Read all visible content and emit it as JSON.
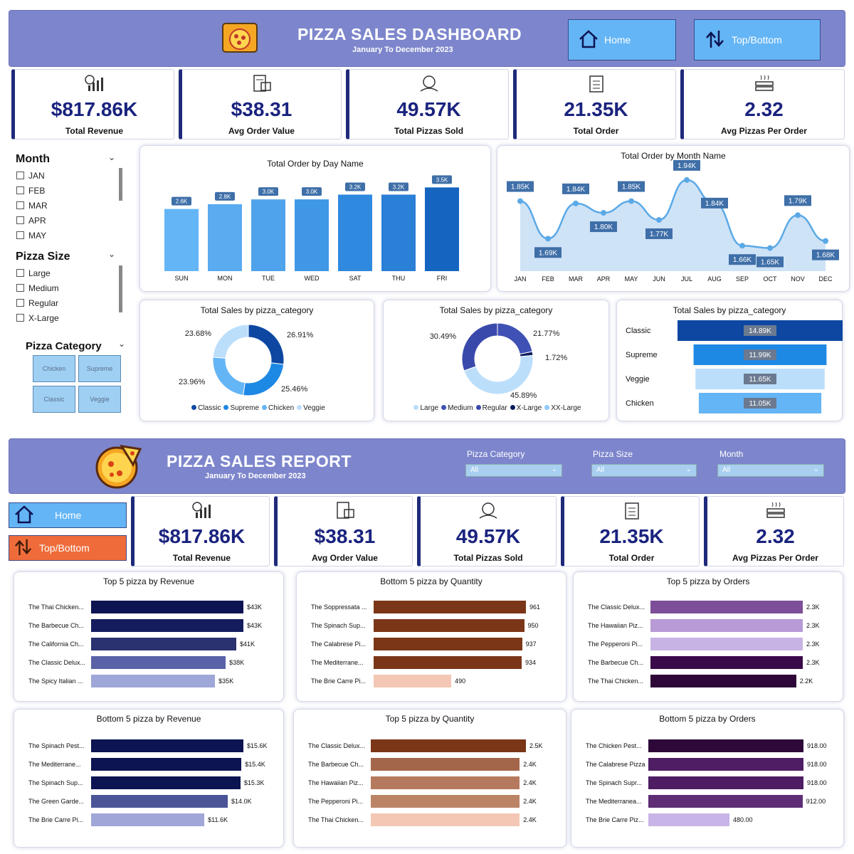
{
  "dashboard": {
    "title": "PIZZA SALES DASHBOARD",
    "subtitle": "January To December 2023",
    "home_label": "Home",
    "topbottom_label": "Top/Bottom"
  },
  "kpis": [
    {
      "value": "$817.86K",
      "label": "Total Revenue"
    },
    {
      "value": "$38.31",
      "label": "Avg Order Value"
    },
    {
      "value": "49.57K",
      "label": "Total Pizzas Sold"
    },
    {
      "value": "21.35K",
      "label": "Total Order"
    },
    {
      "value": "2.32",
      "label": "Avg Pizzas Per Order"
    }
  ],
  "slicers": {
    "month": {
      "title": "Month",
      "items": [
        "JAN",
        "FEB",
        "MAR",
        "APR",
        "MAY"
      ]
    },
    "size": {
      "title": "Pizza Size",
      "items": [
        "Large",
        "Medium",
        "Regular",
        "X-Large"
      ]
    },
    "category": {
      "title": "Pizza Category",
      "tiles": [
        "Chicken",
        "Supreme",
        "Classic",
        "Veggie"
      ]
    }
  },
  "chart_data": [
    {
      "type": "bar",
      "title": "Total Order by Day Name",
      "categories": [
        "SUN",
        "MON",
        "TUE",
        "WED",
        "SAT",
        "THU",
        "FRI"
      ],
      "values": [
        2.6,
        2.8,
        3.0,
        3.0,
        3.2,
        3.2,
        3.5
      ],
      "labels": [
        "2.6K",
        "2.8K",
        "3.0K",
        "3.0K",
        "3.2K",
        "3.2K",
        "3.5K"
      ],
      "colors": [
        "#64b5f6",
        "#5aabf0",
        "#4fa3ec",
        "#3f97e6",
        "#2f89de",
        "#2a7fd6",
        "#1565c0"
      ]
    },
    {
      "type": "area",
      "title": "Total Order by Month Name",
      "categories": [
        "JAN",
        "FEB",
        "MAR",
        "APR",
        "MAY",
        "JUN",
        "JUL",
        "AUG",
        "SEP",
        "OCT",
        "NOV",
        "DEC"
      ],
      "values": [
        1.85,
        1.69,
        1.84,
        1.8,
        1.85,
        1.77,
        1.94,
        1.84,
        1.66,
        1.65,
        1.79,
        1.68
      ],
      "labels": [
        "1.85K",
        "1.69K",
        "1.84K",
        "1.80K",
        "1.85K",
        "1.77K",
        "1.94K",
        "1.84K",
        "1.66K",
        "1.65K",
        "1.79K",
        "1.68K"
      ],
      "ylim": [
        1.6,
        1.97
      ]
    },
    {
      "type": "pie",
      "title": "Total Sales by pizza_category",
      "labels": [
        "26.91%",
        "25.46%",
        "23.96%",
        "23.68%"
      ],
      "values": [
        26.91,
        25.46,
        23.96,
        23.68
      ],
      "series": [
        "Classic",
        "Supreme",
        "Chicken",
        "Veggie"
      ],
      "colors": [
        "#0d47a1",
        "#1e88e5",
        "#64b5f6",
        "#bbdefb"
      ]
    },
    {
      "type": "pie",
      "title": "Total Sales by pizza_category",
      "labels": [
        "21.77%",
        "1.72%",
        "45.89%",
        "30.49%"
      ],
      "values": [
        21.77,
        1.72,
        45.89,
        30.49
      ],
      "series": [
        "Large",
        "Medium",
        "Regular",
        "X-Large",
        "XX-Large"
      ],
      "slice_series": [
        "Medium",
        "X-Large",
        "Large",
        "Regular"
      ],
      "colors": [
        "#3f51b5",
        "#0d1b5e",
        "#bbdefb",
        "#3949ab"
      ],
      "legend_colors": [
        "#bbdefb",
        "#3f51b5",
        "#3949ab",
        "#0d1b5e",
        "#90caf9"
      ]
    },
    {
      "type": "bar",
      "orientation": "horizontal",
      "title": "Total Sales by pizza_category",
      "categories": [
        "Classic",
        "Supreme",
        "Veggie",
        "Chicken"
      ],
      "values": [
        14.89,
        11.99,
        11.65,
        11.05
      ],
      "labels": [
        "14.89K",
        "11.99K",
        "11.65K",
        "11.05K"
      ],
      "colors": [
        "#0d47a1",
        "#1e88e5",
        "#bbdefb",
        "#64b5f6"
      ]
    },
    {
      "type": "bar",
      "orientation": "horizontal",
      "title": "Top 5 pizza by Revenue",
      "categories": [
        "The Thai Chicken...",
        "The Barbecue Ch...",
        "The California Ch...",
        "The Classic Delux...",
        "The Spicy Italian ..."
      ],
      "values": [
        43,
        43,
        41,
        38,
        35
      ],
      "labels": [
        "$43K",
        "$43K",
        "$41K",
        "$38K",
        "$35K"
      ],
      "colors": [
        "#0d1452",
        "#141c5e",
        "#2b3270",
        "#5a63a8",
        "#9fa6d8"
      ]
    },
    {
      "type": "bar",
      "orientation": "horizontal",
      "title": "Bottom 5 pizza by Quantity",
      "categories": [
        "The Soppressata ...",
        "The Spinach Sup...",
        "The Calabrese Pi...",
        "The Mediterrane...",
        "The Brie Carre Pi..."
      ],
      "values": [
        961,
        950,
        937,
        934,
        490
      ],
      "labels": [
        "961",
        "950",
        "937",
        "934",
        "490"
      ],
      "colors": [
        "#7b3618",
        "#7b3618",
        "#7b3618",
        "#7b3618",
        "#f4c7b4"
      ]
    },
    {
      "type": "bar",
      "orientation": "horizontal",
      "title": "Top 5 pizza by Orders",
      "categories": [
        "The Classic Delux...",
        "The Hawaiian Piz...",
        "The Pepperoni Pi...",
        "The Barbecue Ch...",
        "The Thai Chicken..."
      ],
      "values": [
        2.3,
        2.3,
        2.3,
        2.3,
        2.2
      ],
      "labels": [
        "2.3K",
        "2.3K",
        "2.3K",
        "2.3K",
        "2.2K"
      ],
      "colors": [
        "#7c4f98",
        "#b79ad6",
        "#c7b4e4",
        "#3a0a4a",
        "#2d0838"
      ]
    },
    {
      "type": "bar",
      "orientation": "horizontal",
      "title": "Bottom 5 pizza by Revenue",
      "categories": [
        "The Spinach Pest...",
        "The Mediterrane...",
        "The Spinach Sup...",
        "The Green Garde...",
        "The Brie Carre Pi..."
      ],
      "values": [
        15.6,
        15.4,
        15.3,
        14.0,
        11.6
      ],
      "labels": [
        "$15.6K",
        "$15.4K",
        "$15.3K",
        "$14.0K",
        "$11.6K"
      ],
      "colors": [
        "#0d1452",
        "#0d1452",
        "#0d1452",
        "#4a5598",
        "#a0a6d8"
      ]
    },
    {
      "type": "bar",
      "orientation": "horizontal",
      "title": "Top 5 pizza by Quantity",
      "categories": [
        "The Classic Delux...",
        "The Barbecue Ch...",
        "The Hawaiian Piz...",
        "The Pepperoni Pi...",
        "The Thai Chicken..."
      ],
      "values": [
        2.5,
        2.4,
        2.4,
        2.4,
        2.4
      ],
      "labels": [
        "2.5K",
        "2.4K",
        "2.4K",
        "2.4K",
        "2.4K"
      ],
      "colors": [
        "#7b3618",
        "#a4664a",
        "#b57a5e",
        "#bb8467",
        "#f4c7b4"
      ]
    },
    {
      "type": "bar",
      "orientation": "horizontal",
      "title": "Bottom 5 pizza by Orders",
      "categories": [
        "The Chicken Pest...",
        "The Calabrese Pizza",
        "The Spinach Supr...",
        "The Mediterranea...",
        "The Brie Carre Piz..."
      ],
      "values": [
        918,
        918,
        918,
        912,
        480
      ],
      "labels": [
        "918.00",
        "918.00",
        "918.00",
        "912.00",
        "480.00"
      ],
      "colors": [
        "#2d0838",
        "#4e1d64",
        "#4e1d64",
        "#5e2d76",
        "#c8b4e6"
      ]
    }
  ],
  "report": {
    "title": "PIZZA SALES REPORT",
    "subtitle": "January To December 2023",
    "home_label": "Home",
    "topbottom_label": "Top/Bottom",
    "filters": [
      {
        "label": "Pizza Category",
        "value": "All"
      },
      {
        "label": "Pizza Size",
        "value": "All"
      },
      {
        "label": "Month",
        "value": "All"
      }
    ]
  },
  "colors": {
    "banner": "#7d86cc",
    "kpi_text": "#1a237e",
    "home_btn": "#64b5f6",
    "topbottom_btn": "#ef6c3a"
  }
}
